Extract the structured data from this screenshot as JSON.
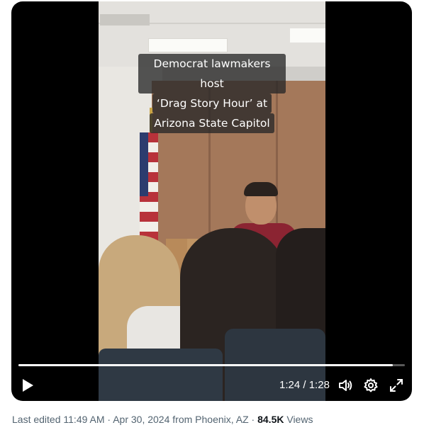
{
  "video": {
    "caption_lines": [
      "Democrat lawmakers host",
      "‘Drag Story Hour’ at",
      "Arizona State Capitol"
    ],
    "progress_fraction": 0.969,
    "current_time": "1:24",
    "separator": "/",
    "duration": "1:28",
    "icons": {
      "play": "play-icon",
      "volume": "volume-icon",
      "settings": "gear-icon",
      "fullscreen": "fullscreen-icon"
    }
  },
  "meta": {
    "edited_label": "Last edited",
    "time": "11:49 AM",
    "dot1": "·",
    "date": "Apr 30, 2024",
    "from_text": "from Phoenix, AZ",
    "dot2": "·",
    "views_count": "84.5K",
    "views_label": "Views"
  },
  "colors": {
    "meta_text": "#536471",
    "emphasis_text": "#0f1419",
    "player_bg": "#000000"
  }
}
